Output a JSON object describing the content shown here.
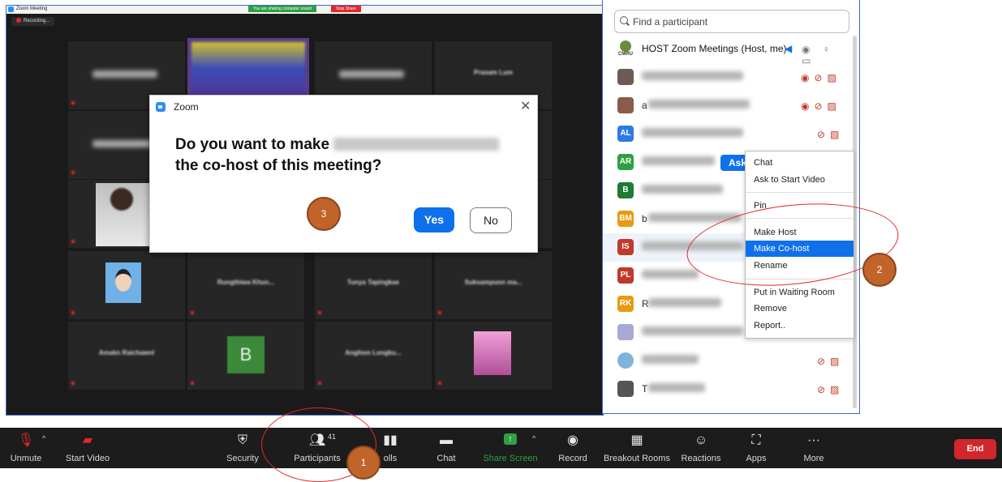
{
  "meeting": {
    "window_title": "Zoom Meeting",
    "sharing_notice": "You are sharing computer sound",
    "stop_share": "Stop Share",
    "recording_label": "Recording..."
  },
  "tiles": [
    {
      "name": "Amakn Raichawnl"
    },
    {
      "name": "Rungthiwa Khun..."
    },
    {
      "name": "Tunya Tapingkae"
    },
    {
      "name": "Suksampunn ma..."
    },
    {
      "name": "Anglism Longku..."
    },
    {
      "name": "Prasam Lum"
    }
  ],
  "tile_b_letter": "B",
  "dialog": {
    "title": "Zoom",
    "question_prefix": "Do you want to make",
    "question_suffix": "the co-host of this meeting?",
    "yes": "Yes",
    "no": "No",
    "close": "✕"
  },
  "panel": {
    "search_placeholder": "Find a participant",
    "host_name": "HOST Zoom Meetings (Host, me)",
    "host_avatar_label": "CMRU",
    "ask_button": "Ask",
    "participants": [
      {
        "initials": "AL",
        "color": "#2d7be0"
      },
      {
        "initials": "AR",
        "color": "#2ea043"
      },
      {
        "initials": "B",
        "color": "#1e7a34"
      },
      {
        "initials": "BM",
        "color": "#e79a13"
      },
      {
        "initials": "IS",
        "color": "#c0392b"
      },
      {
        "initials": "PL",
        "color": "#c0392b"
      },
      {
        "initials": "RK",
        "color": "#e79a13"
      }
    ],
    "row_letters": {
      "b_row": "b",
      "rk_row": "R",
      "last_row": "T",
      "row_a": "a"
    }
  },
  "context_menu": {
    "items": [
      "Chat",
      "Ask to Start Video",
      "Pin",
      "Make Host",
      "Make Co-host",
      "Rename",
      "Put in Waiting Room",
      "Remove",
      "Report.."
    ],
    "selected": "Make Co-host"
  },
  "toolbar": {
    "unmute": "Unmute",
    "start_video": "Start Video",
    "security": "Security",
    "participants": "Participants",
    "participants_count": "41",
    "polls": "olls",
    "chat": "Chat",
    "share_screen": "Share Screen",
    "record": "Record",
    "breakout_rooms": "Breakout Rooms",
    "reactions": "Reactions",
    "apps": "Apps",
    "more": "More",
    "end": "End"
  },
  "annotations": {
    "one": "1",
    "two": "2",
    "three": "3"
  },
  "colors": {
    "accent_blue": "#0e71eb",
    "end_red": "#d0262c",
    "annotation_orange": "#c0642a",
    "share_green": "#2ea043"
  }
}
